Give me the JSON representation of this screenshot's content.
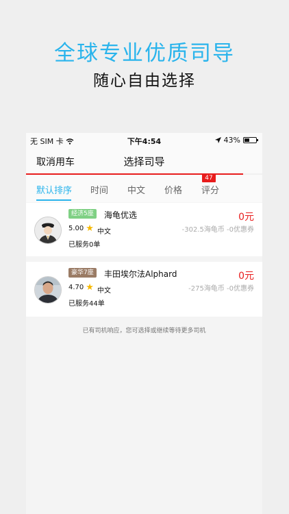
{
  "promo": {
    "headline": "全球专业优质司导",
    "subline": "随心自由选择"
  },
  "status_bar": {
    "carrier": "无 SIM 卡",
    "time": "下午4:54",
    "battery_percent": "43%",
    "battery_level": 0.43,
    "wifi_icon": "wifi-icon",
    "location_icon": "location-arrow-icon"
  },
  "navbar": {
    "cancel_label": "取消用车",
    "title": "选择司导",
    "wait_progress": 0.92
  },
  "tabs": {
    "items": [
      {
        "label": "默认排序",
        "active": true
      },
      {
        "label": "时间",
        "active": false
      },
      {
        "label": "中文",
        "active": false
      },
      {
        "label": "价格",
        "active": false
      },
      {
        "label": "评分",
        "active": false
      }
    ],
    "badge_count": "47"
  },
  "drivers": [
    {
      "badge": "经济5座",
      "badge_color": "#7fd084",
      "car": "海龟优选",
      "rating": "5.00",
      "language": "中文",
      "served": "已服务0单",
      "price": "0元",
      "discount": "-302.5海龟币 -0优惠券",
      "avatar": "driver-cap-avatar"
    },
    {
      "badge": "豪华7座",
      "badge_color": "#9a7b65",
      "car": "丰田埃尔法Alphard",
      "rating": "4.70",
      "language": "中文",
      "served": "已服务44单",
      "price": "0元",
      "discount": "-275海龟币 -0优惠券",
      "avatar": "driver-photo-avatar"
    }
  ],
  "footer_message": "已有司机响应，您可选择或继续等待更多司机",
  "colors": {
    "accent": "#2ab4ec",
    "price": "#e81c1c",
    "page_bg": "#efefef"
  }
}
